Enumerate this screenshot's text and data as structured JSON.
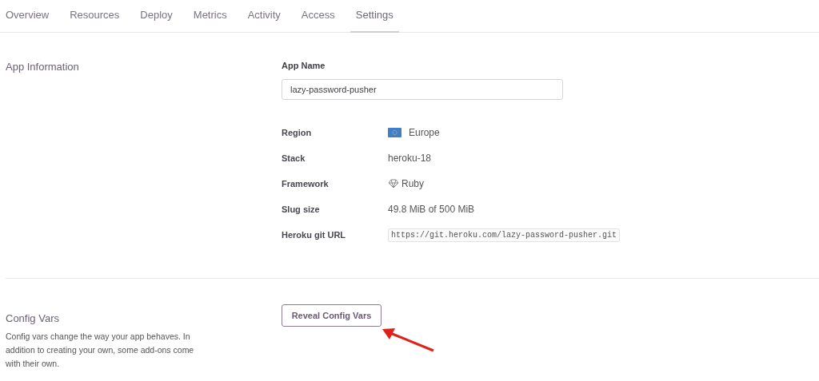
{
  "tabs": [
    {
      "label": "Overview",
      "selected": false
    },
    {
      "label": "Resources",
      "selected": false
    },
    {
      "label": "Deploy",
      "selected": false
    },
    {
      "label": "Metrics",
      "selected": false
    },
    {
      "label": "Activity",
      "selected": false
    },
    {
      "label": "Access",
      "selected": false
    },
    {
      "label": "Settings",
      "selected": true
    }
  ],
  "app_information": {
    "title": "App Information",
    "app_name_label": "App Name",
    "app_name_value": "lazy-password-pusher",
    "details": [
      {
        "kind": "region",
        "label": "Region",
        "value": "Europe"
      },
      {
        "kind": "text",
        "label": "Stack",
        "value": "heroku-18"
      },
      {
        "kind": "framework",
        "label": "Framework",
        "value": "Ruby"
      },
      {
        "kind": "text",
        "label": "Slug size",
        "value": "49.8 MiB of 500 MiB"
      },
      {
        "kind": "code",
        "label": "Heroku git URL",
        "value": "https://git.heroku.com/lazy-password-pusher.git"
      }
    ]
  },
  "config_vars": {
    "title": "Config Vars",
    "description": "Config vars change the way your app behaves. In addition to creating your own, some add-ons come with their own.",
    "button": "Reveal Config Vars"
  }
}
